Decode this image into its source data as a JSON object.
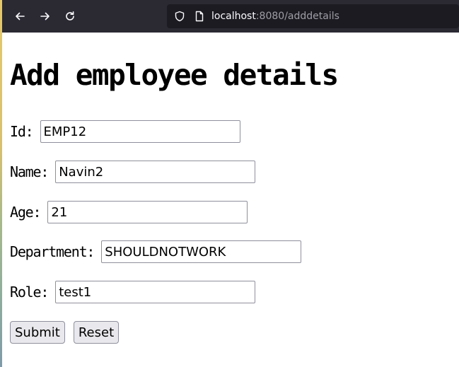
{
  "browser": {
    "url_host": "localhost",
    "url_rest": ":8080/adddetails",
    "icons": [
      "back-arrow-icon",
      "forward-arrow-icon",
      "reload-icon",
      "shield-icon",
      "page-icon"
    ],
    "colors": {
      "toolbar": "#2b2a33",
      "urlbar": "#1c1b22"
    }
  },
  "page": {
    "heading": "Add employee details",
    "fields": [
      {
        "label": "Id:",
        "value": "EMP12"
      },
      {
        "label": "Name:",
        "value": "Navin2"
      },
      {
        "label": "Age:",
        "value": "21"
      },
      {
        "label": "Department:",
        "value": "SHOULDNOTWORK"
      },
      {
        "label": "Role:",
        "value": "test1"
      }
    ],
    "buttons": {
      "submit": "Submit",
      "reset": "Reset"
    }
  }
}
